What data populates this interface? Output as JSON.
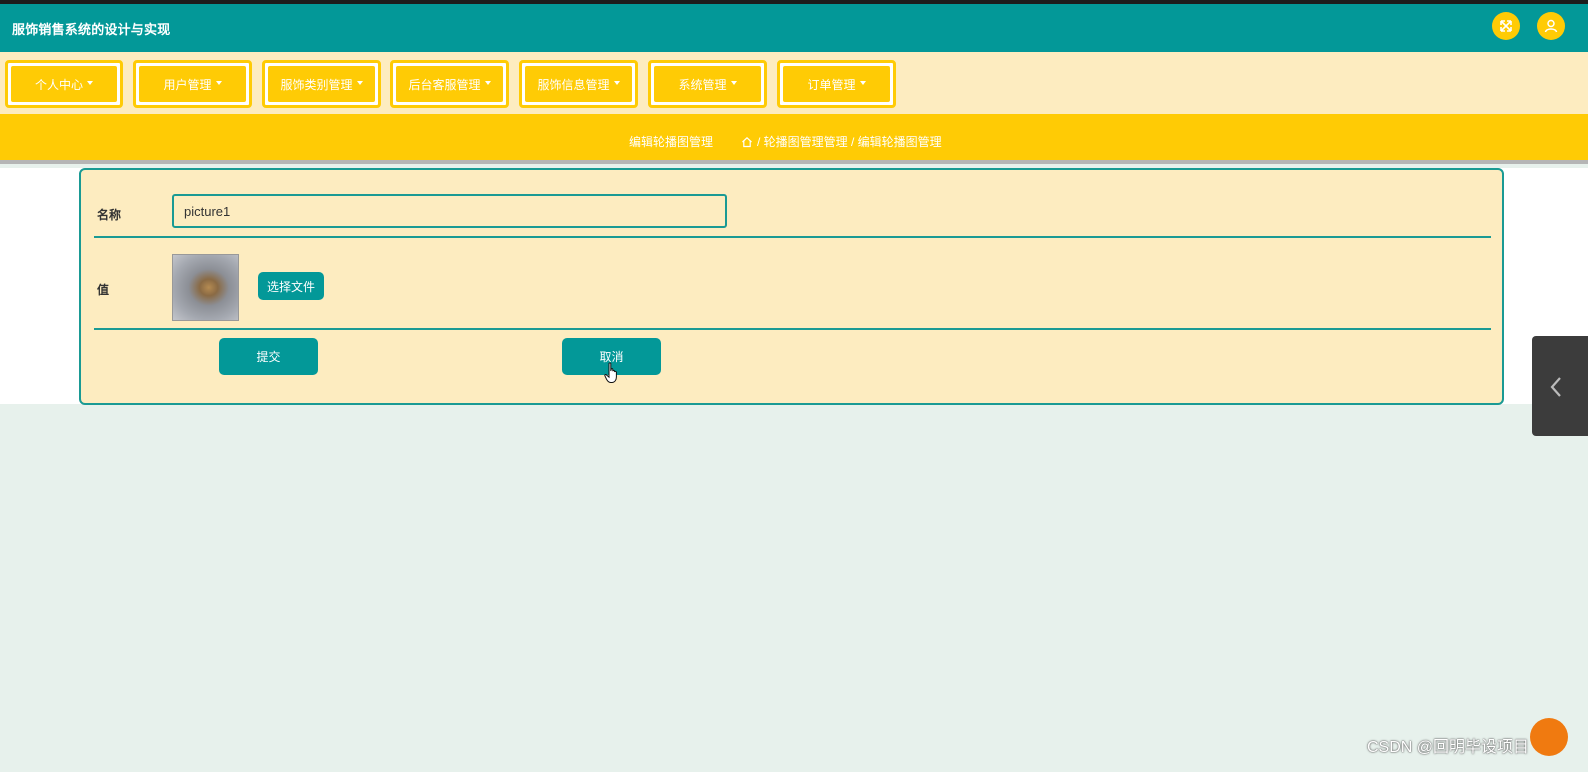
{
  "app": {
    "title": "服饰销售系统的设计与实现"
  },
  "header": {
    "icons": [
      "fullscreen-icon",
      "user-icon"
    ],
    "accent_color": "#039898",
    "button_color": "#ffcb05"
  },
  "nav": {
    "items": [
      {
        "label": "个人中心"
      },
      {
        "label": "用户管理"
      },
      {
        "label": "服饰类别管理"
      },
      {
        "label": "后台客服管理"
      },
      {
        "label": "服饰信息管理"
      },
      {
        "label": "系统管理"
      },
      {
        "label": "订单管理"
      }
    ]
  },
  "breadcrumb": {
    "page_title": "编辑轮播图管理",
    "path": "/ 轮播图管理管理 / 编辑轮播图管理"
  },
  "form": {
    "name_label": "名称",
    "name_value": "picture1",
    "value_label": "值",
    "file_button": "选择文件",
    "submit_button": "提交",
    "cancel_button": "取消"
  },
  "watermark": "CSDN @回明毕设项目"
}
